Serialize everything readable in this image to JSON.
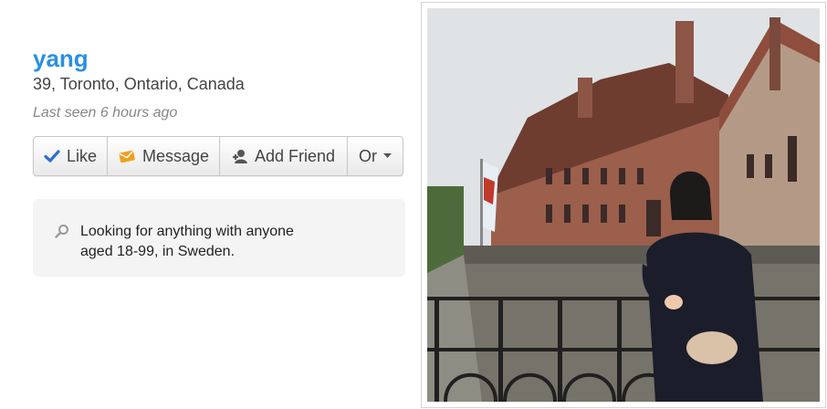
{
  "profile": {
    "name": "yang",
    "location": "39, Toronto, Ontario, Canada",
    "last_seen": "Last seen 6 hours ago"
  },
  "actions": {
    "like_label": "Like",
    "message_label": "Message",
    "add_friend_label": "Add Friend",
    "more_label": "Or"
  },
  "looking_for": {
    "line1": "Looking for anything with anyone",
    "line2": "aged 18-99, in Sweden."
  },
  "icons": {
    "like": "checkmark-icon",
    "message": "envelope-icon",
    "add_friend": "person-add-icon",
    "more": "caret-down-icon",
    "search": "magnifier-icon"
  },
  "colors": {
    "name": "#2b8fe0",
    "like_icon": "#2f6fd1",
    "message_icon": "#f0a020"
  }
}
